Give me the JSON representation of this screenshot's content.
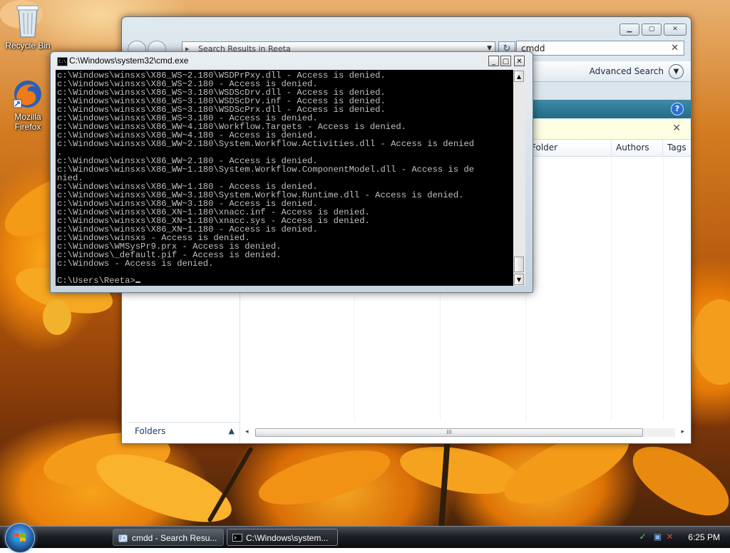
{
  "desktop": {
    "icons": [
      {
        "label": "Recycle Bin"
      },
      {
        "label": "Mozilla Firefox"
      }
    ]
  },
  "explorer": {
    "address": "Search Results in Reeta",
    "search_value": "cmdd",
    "advanced_search": "Advanced Search",
    "columns": [
      "Folder",
      "Authors",
      "Tags"
    ],
    "folders_label": "Folders",
    "scroll_grip": "III"
  },
  "cmd": {
    "title": "C:\\Windows\\system32\\cmd.exe",
    "icon_text": "C:\\",
    "lines": [
      "c:\\Windows\\winsxs\\X86_WS~2.180\\WSDPrPxy.dll - Access is denied.",
      "c:\\Windows\\winsxs\\X86_WS~2.180 - Access is denied.",
      "c:\\Windows\\winsxs\\X86_WS~3.180\\WSDScDrv.dll - Access is denied.",
      "c:\\Windows\\winsxs\\X86_WS~3.180\\WSDScDrv.inf - Access is denied.",
      "c:\\Windows\\winsxs\\X86_WS~3.180\\WSDScPrx.dll - Access is denied.",
      "c:\\Windows\\winsxs\\X86_WS~3.180 - Access is denied.",
      "c:\\Windows\\winsxs\\X86_WW~4.180\\Workflow.Targets - Access is denied.",
      "c:\\Windows\\winsxs\\X86_WW~4.180 - Access is denied.",
      "c:\\Windows\\winsxs\\X86_WW~2.180\\System.Workflow.Activities.dll - Access is denied",
      ".",
      "c:\\Windows\\winsxs\\X86_WW~2.180 - Access is denied.",
      "c:\\Windows\\winsxs\\X86_WW~1.180\\System.Workflow.ComponentModel.dll - Access is de",
      "nied.",
      "c:\\Windows\\winsxs\\X86_WW~1.180 - Access is denied.",
      "c:\\Windows\\winsxs\\X86_WW~3.180\\System.Workflow.Runtime.dll - Access is denied.",
      "c:\\Windows\\winsxs\\X86_WW~3.180 - Access is denied.",
      "c:\\Windows\\winsxs\\X86_XN~1.180\\xnacc.inf - Access is denied.",
      "c:\\Windows\\winsxs\\X86_XN~1.180\\xnacc.sys - Access is denied.",
      "c:\\Windows\\winsxs\\X86_XN~1.180 - Access is denied.",
      "c:\\Windows\\winsxs - Access is denied.",
      "c:\\Windows\\WMSysPr9.prx - Access is denied.",
      "c:\\Windows\\_default.pif - Access is denied.",
      "c:\\Windows - Access is denied.",
      "",
      "C:\\Users\\Reeta>"
    ]
  },
  "taskbar": {
    "buttons": [
      {
        "label": "cmdd - Search Resu..."
      },
      {
        "label": "C:\\Windows\\system..."
      }
    ],
    "clock": "6:25 PM"
  },
  "colors": {
    "console_bg": "#000000",
    "console_fg": "#c0c0c0",
    "explorer_accent": "#2a7c96"
  }
}
